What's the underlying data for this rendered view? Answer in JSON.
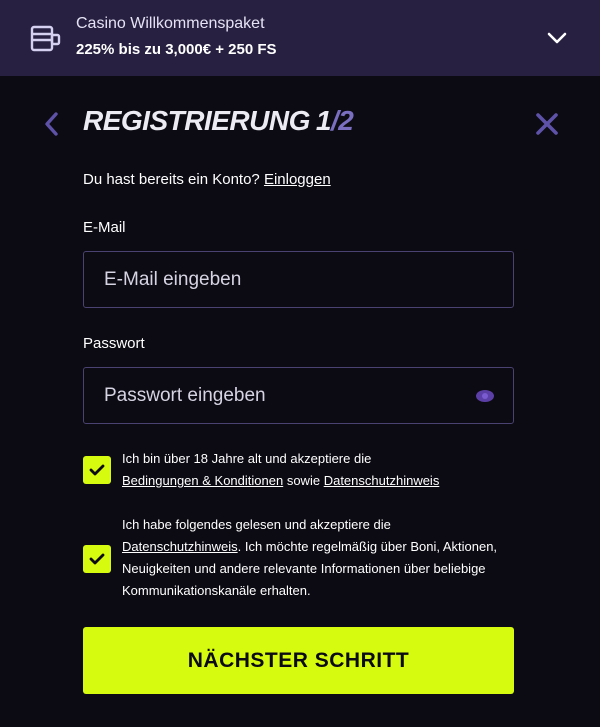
{
  "banner": {
    "title": "Casino Willkommenspaket",
    "offer": "225% bis zu 3,000€ + 250 FS",
    "icon": "bonus-card-icon"
  },
  "header": {
    "title": "REGISTRIERUNG",
    "step_current": "1",
    "step_separator": "/",
    "step_total": "2"
  },
  "account": {
    "prompt": "Du hast bereits ein Konto?",
    "login_link": "Einloggen"
  },
  "form": {
    "email": {
      "label": "E-Mail",
      "placeholder": "E-Mail eingeben",
      "value": ""
    },
    "password": {
      "label": "Passwort",
      "placeholder": "Passwort eingeben",
      "value": ""
    }
  },
  "consents": [
    {
      "checked": true,
      "text_1": "Ich bin über 18 Jahre alt und akzeptiere die",
      "link_1": "Bedingungen & Konditionen",
      "text_2": "sowie",
      "link_2": "Datenschutzhinweis"
    },
    {
      "checked": true,
      "text_1": "Ich habe folgendes gelesen und akzeptiere die",
      "link_1": "Datenschutzhinweis",
      "text_2": ". Ich möchte regelmäßig über Boni, Aktionen, Neuigkeiten und andere relevante Informationen über beliebige Kommunikationskanäle erhalten."
    }
  ],
  "next_button": {
    "label": "NÄCHSTER SCHRITT"
  },
  "colors": {
    "accent": "#d7fb0e",
    "banner_bg": "#272040",
    "page_bg": "#0c0a12",
    "muted_purple": "#7a6ec0"
  }
}
